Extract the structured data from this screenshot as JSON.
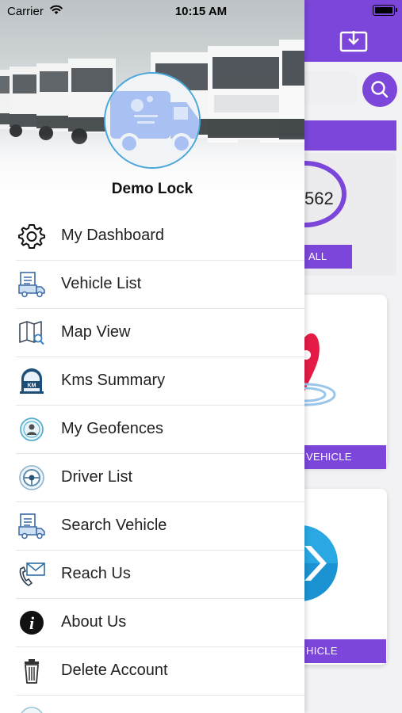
{
  "status_bar": {
    "carrier": "Carrier",
    "time": "10:15 AM"
  },
  "background": {
    "count_value": "562",
    "all_button": "ALL",
    "vehicle_button_1": "VEHICLE",
    "vehicle_button_2": "HICLE",
    "accent_color": "#7b46d9"
  },
  "drawer": {
    "title": "Demo Lock",
    "menu": [
      {
        "label": "My Dashboard",
        "icon": "gear-icon"
      },
      {
        "label": "Vehicle List",
        "icon": "truck-document-icon"
      },
      {
        "label": "Map View",
        "icon": "map-icon"
      },
      {
        "label": "Kms Summary",
        "icon": "km-meter-icon"
      },
      {
        "label": "My Geofences",
        "icon": "geofence-icon"
      },
      {
        "label": "Driver List",
        "icon": "steering-wheel-icon"
      },
      {
        "label": "Search Vehicle",
        "icon": "truck-document-icon"
      },
      {
        "label": "Reach Us",
        "icon": "phone-mail-icon"
      },
      {
        "label": "About Us",
        "icon": "info-icon"
      },
      {
        "label": "Delete Account",
        "icon": "trash-icon"
      }
    ]
  }
}
